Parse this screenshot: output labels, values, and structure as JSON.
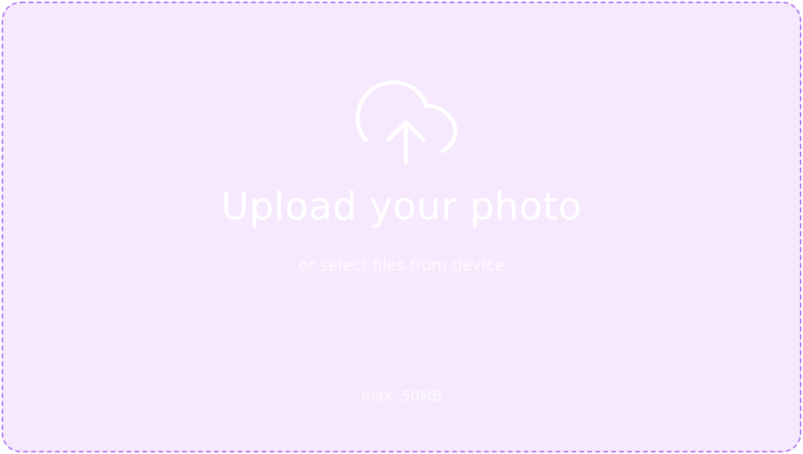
{
  "upload": {
    "title": "Upload your photo",
    "subtitle": "or select files from device",
    "limit": "max. 50MB",
    "icon": "cloud-upload-icon"
  },
  "colors": {
    "background": "#f7e9fd",
    "border": "#b57cf0",
    "text": "#ffffff"
  }
}
